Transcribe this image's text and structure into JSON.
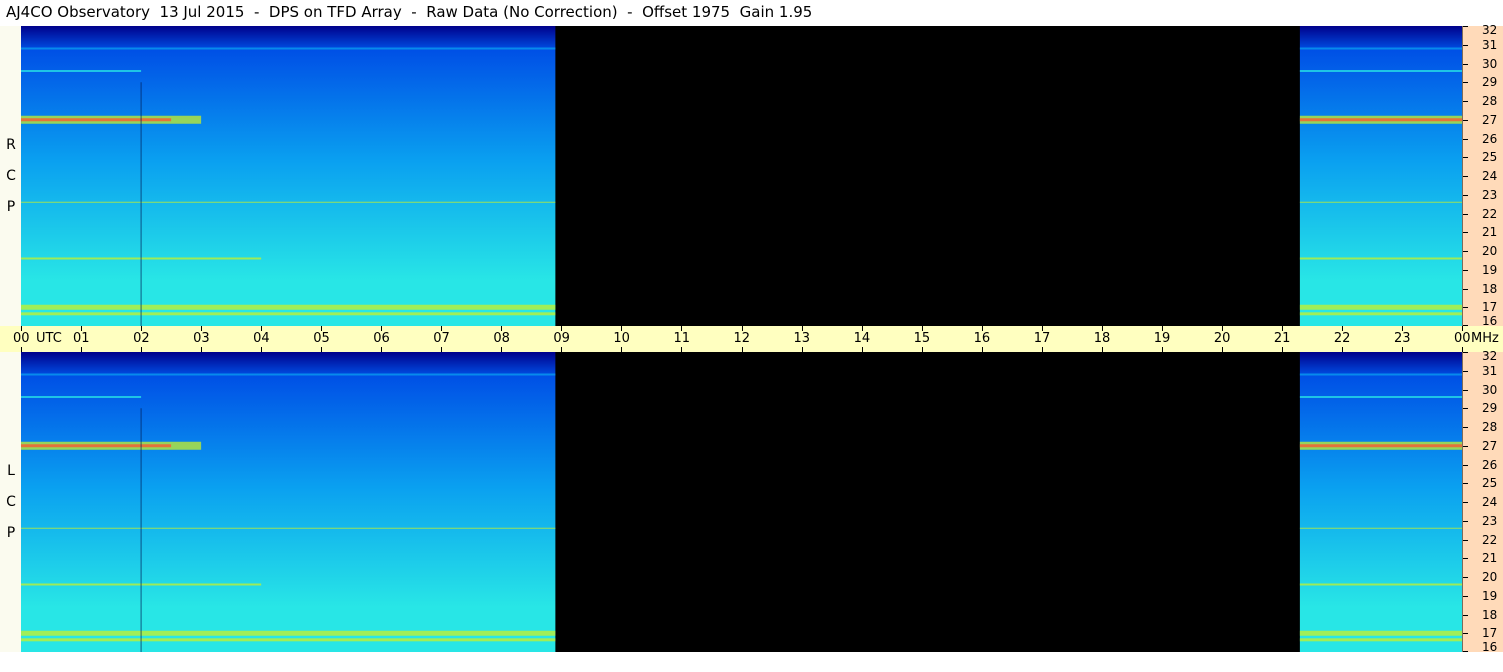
{
  "header": {
    "title": "AJ4CO Observatory  13 Jul 2015  -  DPS on TFD Array  -  Raw Data (No Correction)  -  Offset 1975  Gain 1.95"
  },
  "chart_data": {
    "type": "heatmap",
    "title": "AJ4CO Observatory  13 Jul 2015  -  DPS on TFD Array  -  Raw Data (No Correction)  -  Offset 1975  Gain 1.95",
    "x_axis": {
      "unit_label": "UTC",
      "tick_labels": [
        "00",
        "01",
        "02",
        "03",
        "04",
        "05",
        "06",
        "07",
        "08",
        "09",
        "10",
        "11",
        "12",
        "13",
        "14",
        "15",
        "16",
        "17",
        "18",
        "19",
        "20",
        "21",
        "22",
        "23",
        "00"
      ],
      "range_hours": [
        0,
        24
      ]
    },
    "y_axis": {
      "unit_label": "MHz",
      "tick_labels": [
        "32",
        "31",
        "30",
        "29",
        "28",
        "27",
        "26",
        "25",
        "24",
        "23",
        "22",
        "21",
        "20",
        "19",
        "18",
        "17",
        "16"
      ],
      "range_mhz": [
        16,
        32
      ]
    },
    "panels": [
      {
        "polarization": "R C P",
        "data_hours": [
          [
            0,
            8.9
          ],
          [
            21.3,
            24
          ]
        ],
        "no_data_hours": [
          8.9,
          21.3
        ]
      },
      {
        "polarization": "L C P",
        "data_hours": [
          [
            0,
            8.9
          ],
          [
            21.3,
            24
          ]
        ],
        "no_data_hours": [
          8.9,
          21.3
        ]
      }
    ],
    "strong_bands_mhz": [
      27.0,
      17.0,
      29.6,
      30.8,
      19.6,
      22.6
    ],
    "colormap": [
      "#00008b",
      "#0050e6",
      "#0aa0f0",
      "#28e6e6",
      "#c8f028",
      "#ff5030"
    ]
  }
}
